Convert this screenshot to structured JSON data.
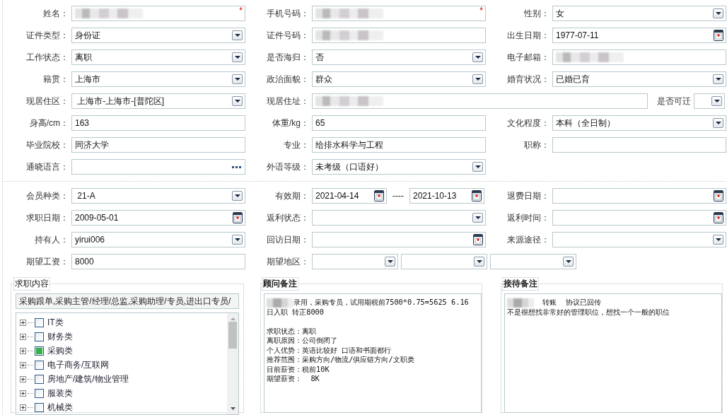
{
  "applicant_section": {
    "rows": [
      [
        {
          "label": "姓名：",
          "kind": "text",
          "redacted": true,
          "required_mark": "*"
        },
        {
          "label": "手机号码：",
          "kind": "text",
          "redacted": true,
          "required_mark": "*"
        },
        {
          "label": "性别：",
          "kind": "select",
          "value": "女"
        }
      ],
      [
        {
          "label": "证件类型：",
          "kind": "select",
          "value": "身份证"
        },
        {
          "label": "证件号码：",
          "kind": "text",
          "redacted": true
        },
        {
          "label": "出生日期：",
          "kind": "date",
          "value": "1977-07-11"
        }
      ],
      [
        {
          "label": "工作状态：",
          "kind": "select",
          "value": "离职"
        },
        {
          "label": "是否海归：",
          "kind": "select",
          "value": "否"
        },
        {
          "label": "电子邮箱：",
          "kind": "text",
          "redacted": true
        }
      ],
      [
        {
          "label": "籍贯：",
          "kind": "select",
          "value": "上海市"
        },
        {
          "label": "政治面貌：",
          "kind": "select",
          "value": "群众"
        },
        {
          "label": "婚育状况：",
          "kind": "select",
          "value": "已婚已育"
        }
      ],
      [
        {
          "label": "现居住区：",
          "kind": "select",
          "value": " 上海市-上海市-[普陀区]"
        },
        {
          "label": "现居住址：",
          "kind": "wide_text",
          "redacted": true
        },
        {
          "label": "是否可迁",
          "kind": "small_select"
        }
      ],
      [
        {
          "label": "身高/cm：",
          "kind": "text",
          "value": "163"
        },
        {
          "label": "体重/kg：",
          "kind": "text",
          "value": "65"
        },
        {
          "label": "文化程度：",
          "kind": "select",
          "value": "本科（全日制）"
        }
      ],
      [
        {
          "label": "毕业院校：",
          "kind": "text",
          "value": "同济大学"
        },
        {
          "label": "专业：",
          "kind": "text",
          "value": "给排水科学与工程"
        },
        {
          "label": "职称：",
          "kind": "text"
        }
      ],
      [
        {
          "label": "通晓语言：",
          "kind": "lookup"
        },
        {
          "label": "外语等级：",
          "kind": "select",
          "value": "未考级（口语好）"
        }
      ]
    ]
  },
  "membership_section": {
    "rows": [
      [
        {
          "label": "会员种类：",
          "kind": "select",
          "value": " 21-A"
        },
        {
          "label": "有效期：",
          "kind": "date_range",
          "separator": "----",
          "parts": [
            {
              "kind": "date",
              "value": "2021-04-14"
            },
            {
              "kind": "date",
              "value": "2021-10-13"
            }
          ]
        },
        {
          "label": "退费日期：",
          "kind": "date"
        }
      ],
      [
        {
          "label": "求职日期：",
          "kind": "date",
          "value": "2009-05-01"
        },
        {
          "label": "返利状态：",
          "kind": "select"
        },
        {
          "label": "返利时间：",
          "kind": "date"
        }
      ],
      [
        {
          "label": "持有人：",
          "kind": "select",
          "value": "yirui006"
        },
        {
          "label": "回访日期：",
          "kind": "date"
        },
        {
          "label": "来源途径：",
          "kind": "select"
        }
      ],
      [
        {
          "label": "期望工资：",
          "kind": "text",
          "value": "8000"
        },
        {
          "label": "期望地区：",
          "kind": "select_group",
          "parts": [
            {
              "kind": "select"
            },
            {
              "kind": "select"
            },
            {
              "kind": "select"
            }
          ]
        }
      ]
    ]
  },
  "job_content": {
    "title": "求职内容",
    "selection": "采购跟单,采购主管/经理/总监,采购助理/专员,进出口专员/",
    "categories": [
      {
        "label": "IT类",
        "checked": false,
        "expanded": false
      },
      {
        "label": "财务类",
        "checked": false,
        "expanded": false
      },
      {
        "label": "采购类",
        "checked": true,
        "expanded": false
      },
      {
        "label": "电子商务/互联网",
        "checked": false,
        "expanded": false
      },
      {
        "label": "房地产/建筑/物业管理",
        "checked": false,
        "expanded": false
      },
      {
        "label": "服装类",
        "checked": false,
        "expanded": false
      },
      {
        "label": "机械类",
        "checked": false,
        "expanded": false
      }
    ]
  },
  "notes": [
    {
      "title": "顾问备注",
      "redacted_prefix": true,
      "paragraphs": [
        [
          "录用，采购专员，试用期税前7500*0.75=5625 6.16",
          "日入职 转正8000"
        ],
        [
          "求职状态：离职",
          "离职原因：公司倒闭了",
          "个人优势：英语比较好 口语和书面都行",
          "推荐范围：采购方向/物流/供应链方向/文职类",
          "目前薪资：税前10K",
          "期望薪资：  8K"
        ]
      ]
    },
    {
      "title": "接待备注",
      "redacted_prefix": true,
      "paragraphs": [
        [
          "  转账  协议已回传",
          "不是很想找非常好的管理职位，想找一个一般的职位"
        ]
      ]
    }
  ]
}
